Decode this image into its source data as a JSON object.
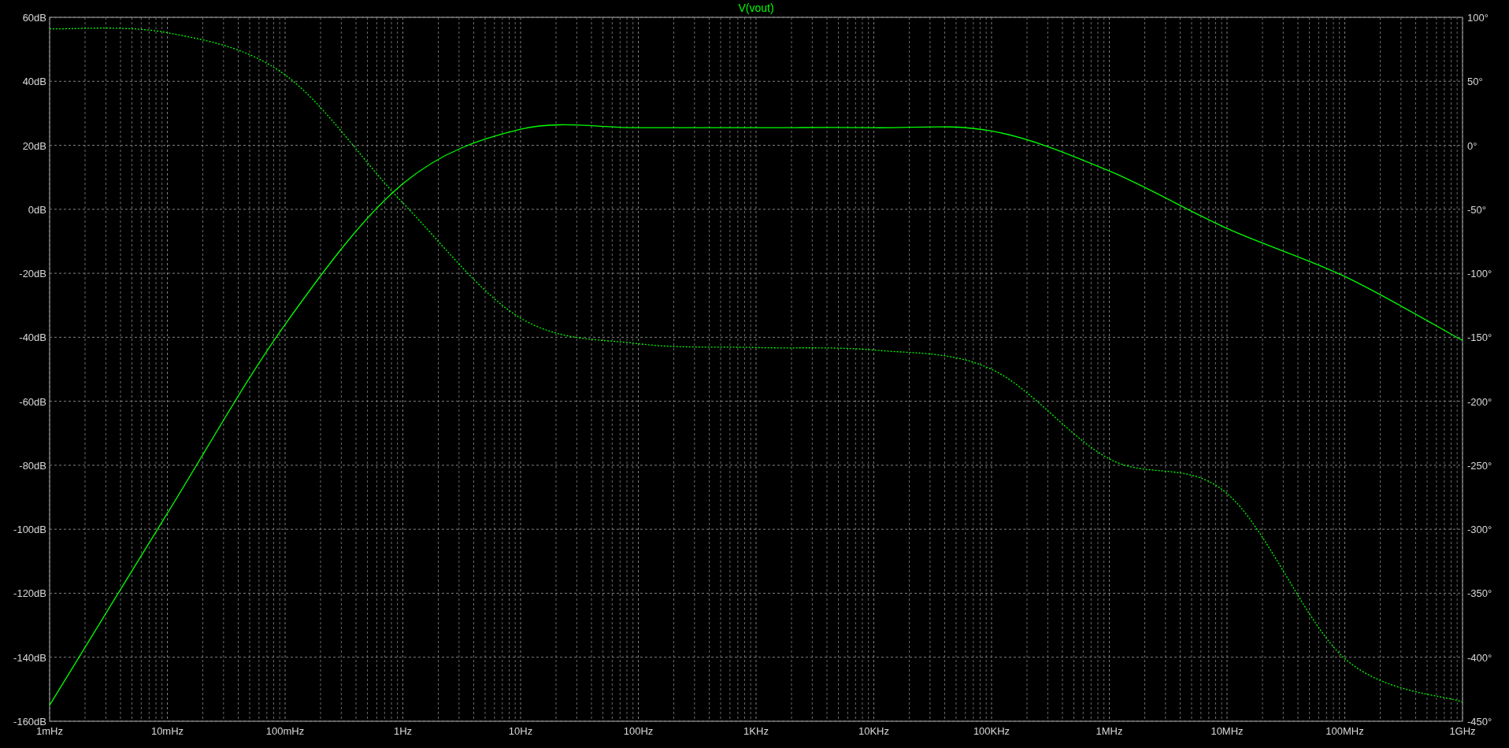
{
  "chart_data": {
    "type": "line",
    "title": "V(vout)",
    "grid": true,
    "categories": [
      "1mHz",
      "10mHz",
      "100mHz",
      "1Hz",
      "10Hz",
      "100Hz",
      "1KHz",
      "10KHz",
      "100KHz",
      "1MHz",
      "10MHz",
      "100MHz",
      "1GHz"
    ],
    "ylim": [
      -160,
      60
    ],
    "yticks": [
      {
        "value": 60,
        "label": "60dB"
      },
      {
        "value": 40,
        "label": "40dB"
      },
      {
        "value": 20,
        "label": "20dB"
      },
      {
        "value": 0,
        "label": "0dB"
      },
      {
        "value": -20,
        "label": "-20dB"
      },
      {
        "value": -40,
        "label": "-40dB"
      },
      {
        "value": -60,
        "label": "-60dB"
      },
      {
        "value": -80,
        "label": "-80dB"
      },
      {
        "value": -100,
        "label": "-100dB"
      },
      {
        "value": -120,
        "label": "-120dB"
      },
      {
        "value": -140,
        "label": "-140dB"
      },
      {
        "value": -160,
        "label": "-160dB"
      }
    ],
    "y2lim": [
      -450,
      100
    ],
    "y2ticks": [
      {
        "value": 100,
        "label": "100°"
      },
      {
        "value": 50,
        "label": "50°"
      },
      {
        "value": 0,
        "label": "0°"
      },
      {
        "value": -50,
        "label": "-50°"
      },
      {
        "value": -100,
        "label": "-100°"
      },
      {
        "value": -150,
        "label": "-150°"
      },
      {
        "value": -200,
        "label": "-200°"
      },
      {
        "value": -250,
        "label": "-250°"
      },
      {
        "value": -300,
        "label": "-300°"
      },
      {
        "value": -350,
        "label": "-350°"
      },
      {
        "value": -400,
        "label": "-400°"
      },
      {
        "value": -450,
        "label": "-450°"
      }
    ],
    "series": [
      {
        "color": "#00ff00",
        "line_style": "solid",
        "values": [
          -155,
          -95,
          -36,
          8,
          25,
          25.5,
          25.5,
          25.5,
          24.5,
          12,
          -6,
          -21,
          -41
        ]
      },
      {
        "color": "#00ff00",
        "line_style": "dotted",
        "axis": "y2",
        "values": [
          91,
          88,
          55,
          -45,
          -135,
          -155,
          -158,
          -160,
          -175,
          -245,
          -272,
          -401,
          -435
        ]
      }
    ]
  }
}
